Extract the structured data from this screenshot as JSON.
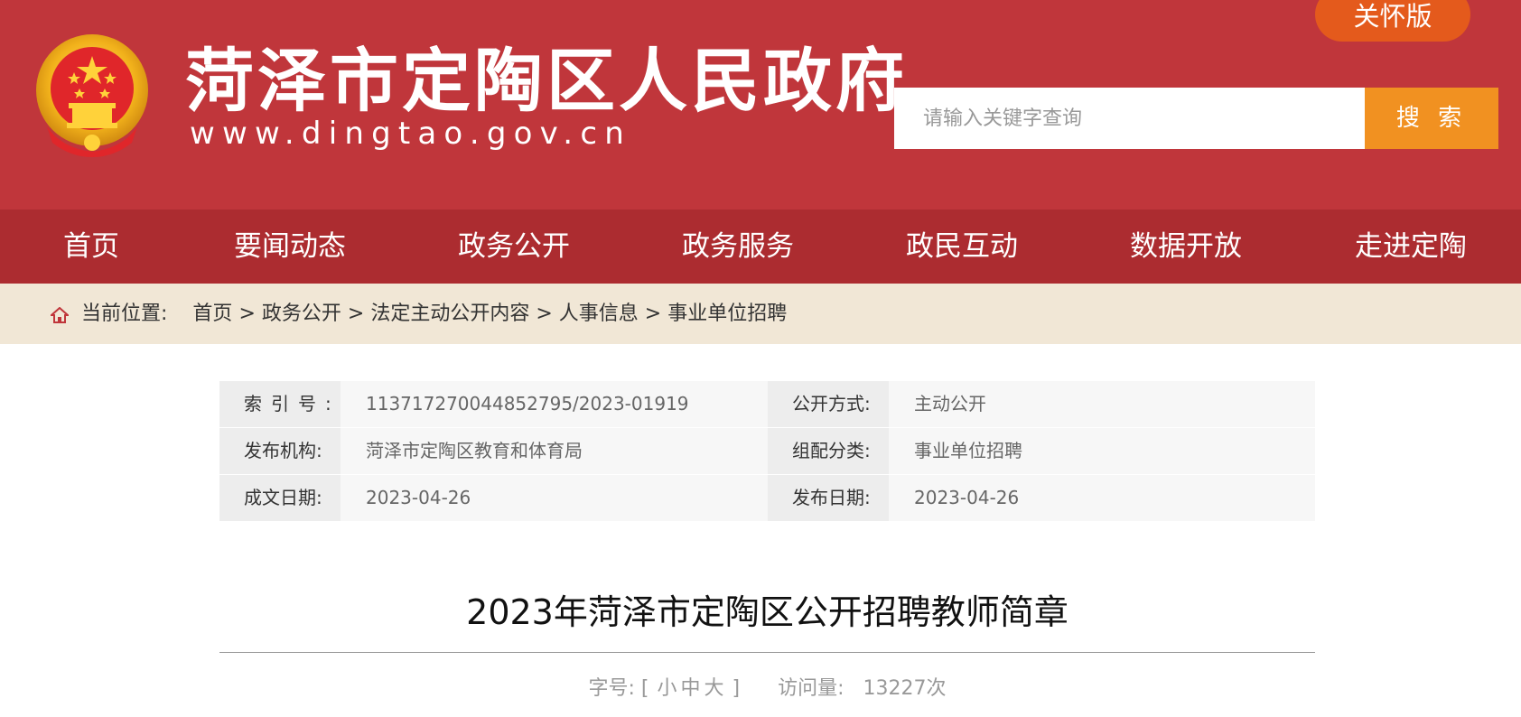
{
  "header": {
    "site_title": "菏泽市定陶区人民政府",
    "site_url": "www.dingtao.gov.cn",
    "care_version_label": "关怀版",
    "search": {
      "placeholder": "请输入关键字查询",
      "button_label": "搜 索"
    },
    "colors": {
      "header_bg": "#c0363b",
      "nav_bg": "#ac2c30",
      "search_button": "#f19121",
      "care_button": "#e45a1c"
    }
  },
  "nav": {
    "items": [
      {
        "label": "首页"
      },
      {
        "label": "要闻动态"
      },
      {
        "label": "政务公开"
      },
      {
        "label": "政务服务"
      },
      {
        "label": "政民互动"
      },
      {
        "label": "数据开放"
      },
      {
        "label": "走进定陶"
      }
    ]
  },
  "breadcrumb": {
    "icon": "home-icon",
    "prefix": "当前位置:",
    "items": [
      "首页",
      "政务公开",
      "法定主动公开内容",
      "人事信息",
      "事业单位招聘"
    ],
    "separator": ">"
  },
  "meta": {
    "rows": [
      {
        "label1": "索引号:",
        "value1": "113717270044852795/2023-01919",
        "label2": "公开方式:",
        "value2": "主动公开"
      },
      {
        "label1": "发布机构:",
        "value1": "菏泽市定陶区教育和体育局",
        "label2": "组配分类:",
        "value2": "事业单位招聘"
      },
      {
        "label1": "成文日期:",
        "value1": "2023-04-26",
        "label2": "发布日期:",
        "value2": "2023-04-26"
      }
    ]
  },
  "article": {
    "title": "2023年菏泽市定陶区公开招聘教师简章",
    "font_size_label": "字号:",
    "font_size_open": "[",
    "font_sizes": [
      "小",
      "中",
      "大"
    ],
    "font_size_close": "]",
    "views_label": "访问量:",
    "views_value": "13227次"
  }
}
